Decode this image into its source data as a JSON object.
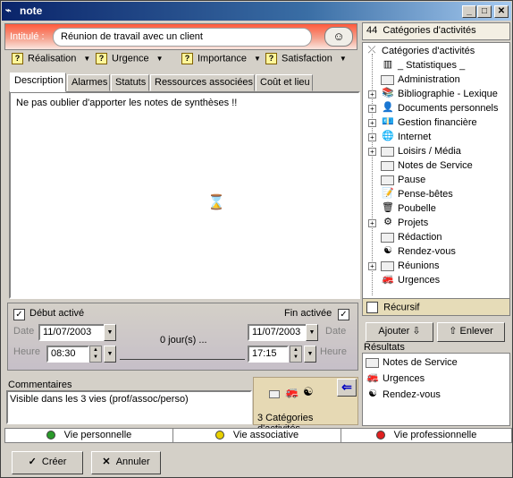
{
  "window": {
    "title": "note",
    "btn_min": "_",
    "btn_max": "□",
    "btn_close": "✕"
  },
  "intitule": {
    "label": "Intitulé :",
    "value": "Réunion de travail avec un client",
    "button_icon": "☺"
  },
  "priorities": [
    {
      "label": "Réalisation"
    },
    {
      "label": "Urgence"
    },
    {
      "label": "Importance"
    },
    {
      "label": "Satisfaction"
    }
  ],
  "tabs": [
    {
      "label": "Description"
    },
    {
      "label": "Alarmes"
    },
    {
      "label": "Statuts"
    },
    {
      "label": "Ressources associées"
    },
    {
      "label": "Coût et lieu"
    }
  ],
  "description": {
    "text": "Ne pas oublier d'apporter les notes de synthèses !!"
  },
  "dates": {
    "debut_label": "Début activé",
    "fin_label": "Fin activée",
    "date_label": "Date",
    "heure_label": "Heure",
    "start_date": "11/07/2003",
    "end_date": "11/07/2003",
    "start_time": "08:30",
    "end_time": "17:15",
    "duration": "0 jour(s) ..."
  },
  "comments": {
    "label": "Commentaires",
    "value": "Visible dans les 3 vies (prof/assoc/perso)"
  },
  "categories_summary": "3 Catégories d'activités",
  "vies": [
    {
      "label": "Vie personnelle",
      "color": "#2a9a2a"
    },
    {
      "label": "Vie associative",
      "color": "#e8d000"
    },
    {
      "label": "Vie professionnelle",
      "color": "#e02020"
    }
  ],
  "buttons": {
    "create": "Créer",
    "cancel": "Annuler"
  },
  "right_panel": {
    "count": "44",
    "header": "Catégories d'activités",
    "root": "Catégories d'activités",
    "items": [
      {
        "label": "_ Statistiques _",
        "icon": "chart-icon",
        "glyph": "▥",
        "expandable": false
      },
      {
        "label": "Administration",
        "icon": "folder-icon",
        "glyph": "",
        "expandable": false
      },
      {
        "label": "Bibliographie - Lexique",
        "icon": "books-icon",
        "glyph": "📚",
        "expandable": true
      },
      {
        "label": "Documents personnels",
        "icon": "person-icon",
        "glyph": "👤",
        "expandable": true
      },
      {
        "label": "Gestion financière",
        "icon": "money-icon",
        "glyph": "💶",
        "expandable": true
      },
      {
        "label": "Internet",
        "icon": "globe-icon",
        "glyph": "🌐",
        "expandable": true
      },
      {
        "label": "Loisirs / Média",
        "icon": "folder-icon",
        "glyph": "",
        "expandable": true
      },
      {
        "label": "Notes de Service",
        "icon": "folder-icon",
        "glyph": "",
        "expandable": false
      },
      {
        "label": "Pause",
        "icon": "folder-icon",
        "glyph": "",
        "expandable": false
      },
      {
        "label": "Pense-bêtes",
        "icon": "notepad-icon",
        "glyph": "📝",
        "expandable": false
      },
      {
        "label": "Poubelle",
        "icon": "trash-icon",
        "glyph": "🗑",
        "expandable": false
      },
      {
        "label": "Projets",
        "icon": "gear-icon",
        "glyph": "⚙",
        "expandable": true
      },
      {
        "label": "Rédaction",
        "icon": "folder-icon",
        "glyph": "",
        "expandable": false
      },
      {
        "label": "Rendez-vous",
        "icon": "yinyang-icon",
        "glyph": "☯",
        "expandable": false
      },
      {
        "label": "Réunions",
        "icon": "folder-icon",
        "glyph": "",
        "expandable": true
      },
      {
        "label": "Urgences",
        "icon": "fire-truck-icon",
        "glyph": "🚒",
        "expandable": false
      }
    ],
    "recursif": "Récursif",
    "add_button": "Ajouter",
    "remove_button": "Enlever",
    "results_label": "Résultats",
    "results": [
      {
        "label": "Notes de Service",
        "icon": "folder-icon",
        "glyph": ""
      },
      {
        "label": "Urgences",
        "icon": "fire-truck-icon",
        "glyph": "🚒"
      },
      {
        "label": "Rendez-vous",
        "icon": "yinyang-icon",
        "glyph": "☯"
      }
    ]
  }
}
